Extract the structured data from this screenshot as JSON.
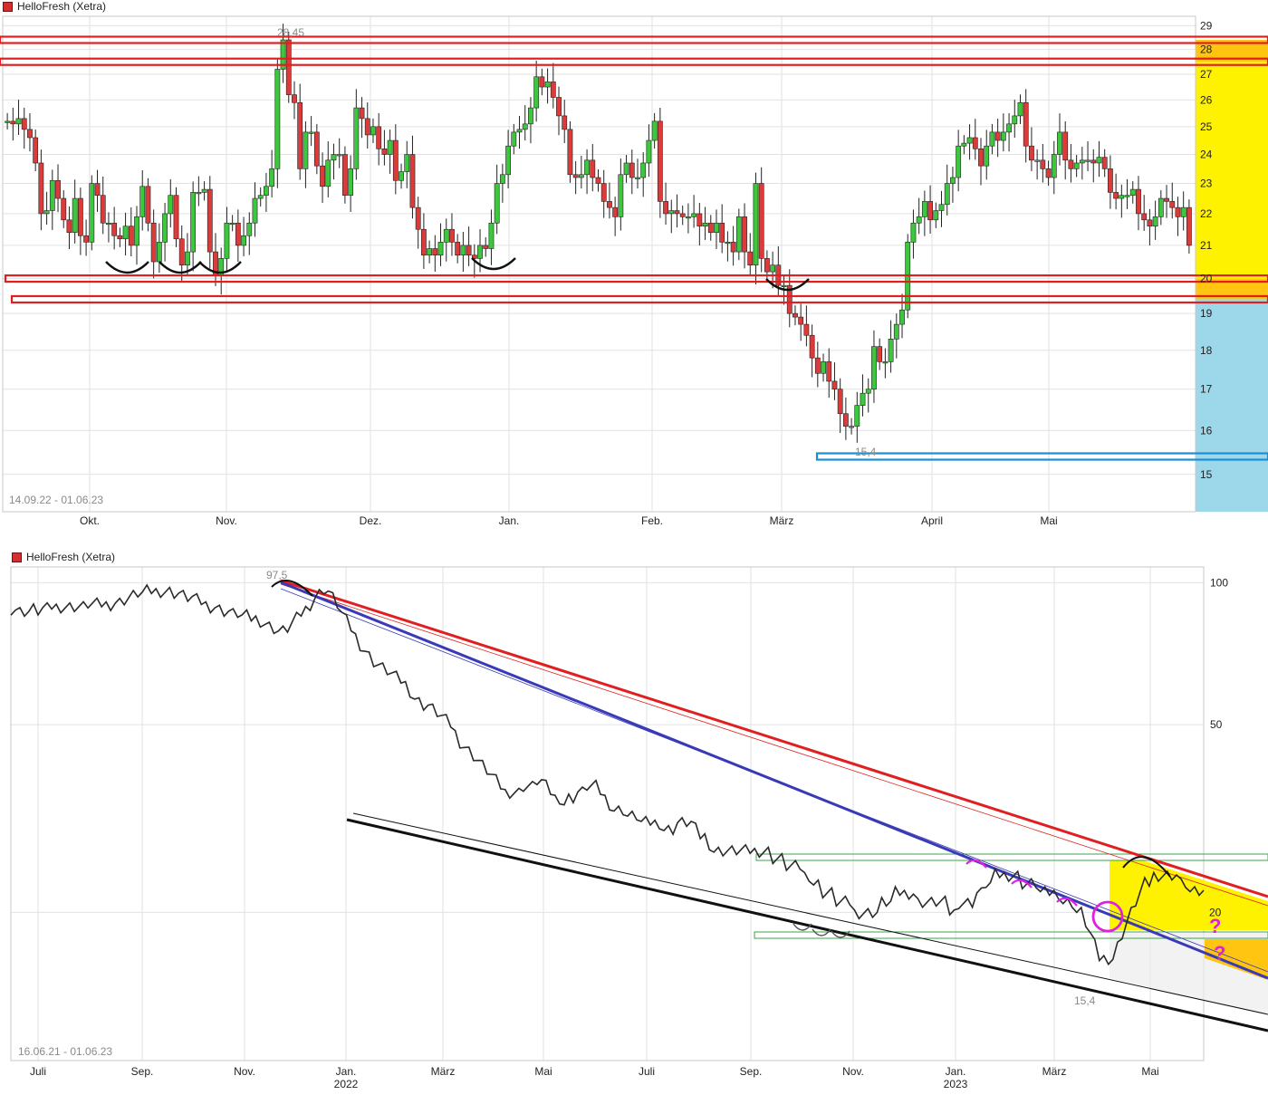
{
  "chart_data": [
    {
      "type": "candlestick",
      "title": "HelloFresh (Xetra)",
      "range_label": "14.09.22 - 01.06.23",
      "y_ticks": [
        "29",
        "28",
        "27",
        "26",
        "25",
        "24",
        "23",
        "22",
        "21",
        "20",
        "19",
        "18",
        "17",
        "16",
        "15"
      ],
      "ylim": [
        14.2,
        29.4
      ],
      "scale": "log",
      "x_ticks": [
        "Okt.",
        "Nov.",
        "Dez.",
        "Jan.",
        "Feb.",
        "März",
        "April",
        "Mai"
      ],
      "annotations": {
        "high": "28,45",
        "low": "15,4"
      },
      "levels": [
        {
          "name": "resistance-28.4",
          "value": 28.4,
          "color": "#e02020"
        },
        {
          "name": "resistance-27.5",
          "value": 27.5,
          "color": "#e02020"
        },
        {
          "name": "support-20.0",
          "value": 20.0,
          "color": "#e02020"
        },
        {
          "name": "support-19.4",
          "value": 19.4,
          "color": "#e02020"
        },
        {
          "name": "support-15.4",
          "value": 15.4,
          "color": "#1a8fd6"
        }
      ],
      "right_zones": [
        {
          "from": 19.4,
          "to": 20.0,
          "color": "#ffc510"
        },
        {
          "from": 20.0,
          "to": 27.5,
          "color": "#fff200"
        },
        {
          "from": 27.5,
          "to": 28.4,
          "color": "#ffc510"
        },
        {
          "from": 14.2,
          "to": 19.4,
          "color": "#9dd7ea"
        }
      ],
      "series": [
        {
          "values": [
            25.2,
            25.1,
            25.3,
            24.9,
            24.6,
            23.7,
            22.0,
            22.1,
            23.1,
            22.5,
            21.8,
            21.4,
            22.5,
            21.3,
            21.1,
            23.0,
            22.6,
            21.7,
            21.7,
            21.3,
            21.2,
            21.6,
            21.0,
            21.9,
            22.9,
            21.7,
            20.5,
            21.1,
            22.0,
            22.6,
            21.2,
            20.4,
            20.8,
            22.7,
            22.7,
            22.8,
            20.8,
            20.1,
            20.6,
            21.7,
            21.7,
            21.0,
            21.3,
            21.7,
            22.5,
            22.6,
            22.9,
            23.5,
            27.2,
            28.4,
            26.2,
            25.9,
            23.5,
            24.8,
            24.8,
            23.6,
            22.9,
            23.8,
            24.0,
            24.0,
            22.6,
            23.5,
            25.7,
            25.3,
            24.7,
            25.0,
            24.2,
            24.0,
            24.5,
            23.1,
            23.4,
            24.0,
            22.2,
            21.5,
            20.7,
            20.9,
            20.7,
            21.1,
            21.5,
            21.1,
            20.7,
            21.0,
            20.7,
            20.6,
            21.0,
            20.9,
            21.7,
            23.0,
            23.3,
            24.3,
            24.8,
            24.9,
            25.1,
            25.7,
            26.9,
            26.5,
            26.7,
            26.1,
            25.4,
            24.9,
            23.3,
            23.2,
            23.3,
            23.8,
            23.2,
            23.0,
            22.4,
            22.2,
            21.9,
            23.3,
            23.7,
            23.2,
            23.2,
            23.7,
            24.5,
            25.2,
            22.4,
            22.0,
            22.1,
            22.0,
            21.9,
            21.9,
            22.0,
            21.6,
            21.7,
            21.4,
            21.7,
            21.1,
            21.1,
            20.8,
            21.9,
            20.8,
            20.4,
            23.0,
            20.6,
            20.2,
            20.4,
            19.8,
            19.8,
            19.0,
            18.9,
            18.7,
            18.4,
            17.8,
            17.4,
            17.7,
            17.2,
            17.0,
            16.4,
            16.1,
            16.1,
            16.6,
            16.9,
            17.0,
            18.1,
            17.7,
            17.7,
            18.3,
            18.7,
            19.1,
            21.1,
            21.7,
            21.9,
            22.4,
            21.8,
            22.1,
            22.3,
            23.0,
            23.2,
            24.3,
            24.4,
            24.6,
            24.2,
            23.6,
            24.3,
            24.8,
            24.5,
            24.8,
            25.1,
            25.4,
            25.9,
            24.3,
            23.8,
            23.8,
            23.5,
            23.2,
            24.0,
            24.8,
            23.8,
            23.5,
            23.7,
            23.8,
            23.8,
            23.7,
            23.9,
            23.5,
            22.7,
            22.5,
            22.6,
            22.6,
            22.8,
            22.0,
            21.8,
            21.6,
            21.9,
            22.5,
            22.4,
            22.2,
            21.9,
            22.2,
            21.0
          ]
        }
      ]
    },
    {
      "type": "line",
      "title": "HelloFresh (Xetra)",
      "range_label": "16.06.21 - 01.06.23",
      "y_ticks": [
        "100",
        "50",
        "20"
      ],
      "ylim": [
        9.7,
        108
      ],
      "scale": "log",
      "x_ticks": [
        "Juli",
        "Sep.",
        "Nov.",
        "Jan.",
        "März",
        "Mai",
        "Juli",
        "Sep.",
        "Nov.",
        "Jan.",
        "März",
        "Mai"
      ],
      "year_labels": [
        "2022",
        "2023"
      ],
      "annotations": {
        "high": "97,5",
        "low": "15,4",
        "question_marks": [
          "?",
          "?"
        ]
      },
      "series": [
        {
          "values": [
            88,
            88,
            87,
            87,
            87,
            88,
            87,
            88,
            88,
            89,
            89,
            89,
            89,
            89,
            89,
            89,
            89,
            90,
            90,
            90,
            90,
            90,
            90,
            91,
            91,
            92,
            93,
            94,
            95,
            95,
            96,
            96,
            96,
            96,
            96,
            96,
            95,
            95,
            94,
            93,
            93,
            92,
            91,
            90,
            89,
            89,
            88,
            87,
            87,
            86,
            86,
            85,
            85,
            84,
            84,
            83,
            82,
            81,
            80,
            79,
            79,
            80,
            82,
            84,
            86,
            88,
            90,
            93,
            95,
            97,
            96,
            93,
            90,
            86,
            83,
            80,
            77,
            74,
            72,
            70,
            68,
            67,
            66,
            65,
            64,
            63,
            62,
            61,
            59,
            57,
            56,
            55,
            55,
            54,
            53,
            52,
            51,
            50,
            48,
            46,
            45,
            44,
            43,
            42,
            41,
            40,
            39,
            38,
            37,
            36,
            36,
            36,
            36,
            37,
            37,
            37,
            38,
            38,
            37,
            36,
            35,
            35,
            34,
            35,
            35,
            36,
            36,
            37,
            37,
            37,
            36,
            35,
            34,
            33,
            33,
            33,
            32,
            32,
            32,
            31,
            31,
            31,
            31,
            31,
            30,
            30,
            30,
            31,
            31,
            31,
            31,
            30,
            29,
            29,
            28,
            27,
            27,
            27,
            27,
            27,
            27,
            27,
            27,
            27,
            27,
            27,
            27,
            27,
            26,
            26,
            26,
            25,
            25,
            25,
            25,
            24,
            24,
            23,
            23,
            22,
            22,
            22,
            21,
            21,
            21,
            21,
            20,
            20,
            20,
            20,
            20,
            20,
            21,
            21,
            21,
            22,
            22,
            22,
            22,
            22,
            21,
            21,
            21,
            21,
            21,
            21,
            21,
            20,
            20,
            21,
            21,
            21,
            21,
            22,
            22,
            23,
            23,
            24,
            24,
            24,
            24,
            24,
            24,
            23,
            23,
            23,
            23,
            22,
            22,
            22,
            22,
            22,
            21,
            21,
            21,
            20,
            20,
            19,
            18,
            17,
            16,
            16,
            16,
            16,
            17,
            18,
            19,
            20,
            21,
            22,
            23,
            23,
            24,
            24,
            24,
            24,
            24,
            24,
            23,
            23,
            22,
            22,
            22,
            22
          ]
        }
      ]
    }
  ]
}
